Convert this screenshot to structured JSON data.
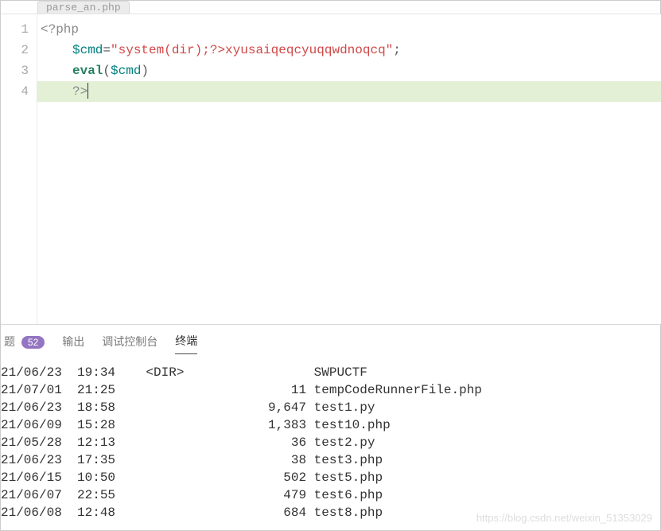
{
  "tab": {
    "filename": "parse_an.php"
  },
  "editor": {
    "line_numbers": [
      "1",
      "2",
      "3",
      "4"
    ],
    "code": {
      "l1_open": "<?php",
      "l2_var": "$cmd",
      "l2_eq": "=",
      "l2_str": "\"system(dir);?>xyusaiqeqcyuqqwdnoqcq\"",
      "l2_semi": ";",
      "l3_fn": "eval",
      "l3_open": "(",
      "l3_var": "$cmd",
      "l3_close": ")",
      "l4_close": "?>"
    }
  },
  "panel": {
    "tabs": {
      "problems": "题",
      "badge": "52",
      "output": "输出",
      "debug": "调试控制台",
      "terminal": "终端"
    },
    "terminal_rows": [
      {
        "date": "21/06/23",
        "time": "19:34",
        "type": "<DIR>",
        "size": "",
        "name": "SWPUCTF"
      },
      {
        "date": "21/07/01",
        "time": "21:25",
        "type": "",
        "size": "11",
        "name": "tempCodeRunnerFile.php"
      },
      {
        "date": "21/06/23",
        "time": "18:58",
        "type": "",
        "size": "9,647",
        "name": "test1.py"
      },
      {
        "date": "21/06/09",
        "time": "15:28",
        "type": "",
        "size": "1,383",
        "name": "test10.php"
      },
      {
        "date": "21/05/28",
        "time": "12:13",
        "type": "",
        "size": "36",
        "name": "test2.py"
      },
      {
        "date": "21/06/23",
        "time": "17:35",
        "type": "",
        "size": "38",
        "name": "test3.php"
      },
      {
        "date": "21/06/15",
        "time": "10:50",
        "type": "",
        "size": "502",
        "name": "test5.php"
      },
      {
        "date": "21/06/07",
        "time": "22:55",
        "type": "",
        "size": "479",
        "name": "test6.php"
      },
      {
        "date": "21/06/08",
        "time": "12:48",
        "type": "",
        "size": "684",
        "name": "test8.php"
      }
    ]
  },
  "watermark": "https://blog.csdn.net/weixin_51353029"
}
